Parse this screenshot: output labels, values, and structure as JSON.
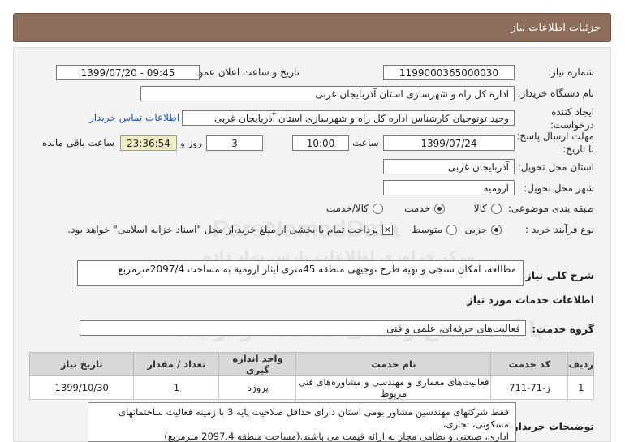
{
  "header": {
    "title": "جزئیات اطلاعات نیاز"
  },
  "fields": {
    "need_number_label": "شماره نیاز:",
    "need_number": "1199000365000030",
    "announce_label": "تاریخ و ساعت اعلان عمومی:",
    "announce_value": "1399/07/20 - 09:45",
    "buyer_label": "نام دستگاه خریدار:",
    "buyer_value": "اداره کل راه و شهرسازی استان آذربایجان غربی",
    "creator_label": "ایجاد کننده درخواست:",
    "creator_value": "وحید تونوچیان کارشناس اداره کل راه و شهرسازی استان آذربایجان غربی",
    "contact_link": "اطلاعات تماس خریدار",
    "deadline_label": "مهلت ارسال پاسخ: تا تاریخ:",
    "deadline_date": "1399/07/24",
    "time_label": "ساعت",
    "deadline_time": "10:00",
    "days_value": "3",
    "days_label": "روز و",
    "remaining_value": "23:36:54",
    "remaining_label": "ساعت باقی مانده",
    "province_label": "استان محل تحویل:",
    "province_value": "آذربایجان غربی",
    "city_label": "شهر محل تحویل:",
    "city_value": "ارومیه",
    "category_label": "طبقه بندی موضوعی:",
    "category_options": [
      "کالا",
      "خدمت",
      "کالا/خدمت"
    ],
    "process_label": "نوع فرآیند خرید :",
    "process_options": [
      "جزیی",
      "متوسط"
    ],
    "payment_note": "پرداخت تمام یا بخشی از مبلغ خرید،از محل \"اسناد خزانه اسلامی\" خواهد بود."
  },
  "summary": {
    "label": "شرح کلی نیاز:",
    "value": "مطالعه، امکان سنجی و تهیه طرح توجیهی منطقه 45متری ایثار ارومیه به مساحت 2097/4مترمربع"
  },
  "services": {
    "section_title": "اطلاعات خدمات مورد نیاز",
    "group_label": "گروه خدمت:",
    "group_value": "فعالیت‌های حرفه‌ای، علمی و فنی",
    "columns": [
      "ردیف",
      "کد خدمت",
      "نام خدمت",
      "واحد اندازه گیری",
      "تعداد / مقدار",
      "تاریخ نیاز"
    ],
    "rows": [
      [
        "1",
        "ز-71-711",
        "فعالیت‌های معماری و مهندسی و مشاوره‌های فنی مربوط",
        "پروژه",
        "1",
        "1399/10/30"
      ]
    ]
  },
  "buyer_notes": {
    "label": "توضیحات خریدار:",
    "lines": [
      "فقط شرکتهای مهندسین مشاور بومی استان دارای حداقل صلاحیت پایه 3 با زمینه فعالیت ساختمانهای مسکونی، تجاری،",
      "اداری، صنعتی و نظامی مجاز به ارائه قیمت می باشند.(مساحت منطقه 2097.4 مترمربع)"
    ]
  },
  "watermark": {
    "line1": "ParsNamadData",
    "line2": "مرکز فراوری اطلاعات پارس نماد داده",
    "line3": "پایگاه اطلاع رسانی مناقصه ومزایده",
    "line4": "۰۲۱-۸۸۳۴۹۶۷۰-۵"
  },
  "colors": {
    "header_bg": "#8d6e5a",
    "panel_bg": "#f3f3f3",
    "link": "#1f55b5",
    "remaining_bg": "#f0ecc4"
  }
}
